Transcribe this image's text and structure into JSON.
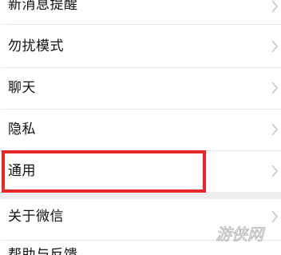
{
  "settings": {
    "items": [
      {
        "label": "新消息提醒"
      },
      {
        "label": "勿扰模式"
      },
      {
        "label": "聊天"
      },
      {
        "label": "隐私"
      },
      {
        "label": "通用"
      },
      {
        "label": "关于微信"
      },
      {
        "label": "帮助与反馈"
      }
    ]
  },
  "watermark": {
    "text": "游侠网"
  },
  "colors": {
    "background": "#ededed",
    "row": "#ffffff",
    "highlight": "#e8292b",
    "chevron": "#c4c4c4"
  },
  "icons": {
    "chevron": "chevron-right-icon",
    "watermark": "watermark-logo"
  }
}
